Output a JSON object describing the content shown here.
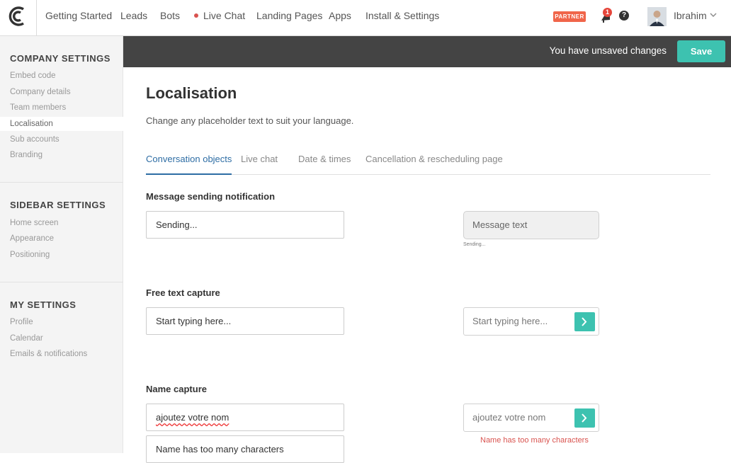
{
  "nav": {
    "items": [
      "Getting Started",
      "Leads",
      "Bots",
      "Live Chat",
      "Landing Pages",
      "Apps",
      "Install & Settings"
    ],
    "partner_badge": "PARTNER",
    "notification_count": "1",
    "help_icon": "question-circle-icon",
    "username": "Ibrahim"
  },
  "unsaved": {
    "message": "You have unsaved changes",
    "save_label": "Save"
  },
  "sidebar": {
    "company": {
      "heading": "COMPANY SETTINGS",
      "items": [
        "Embed code",
        "Company details",
        "Team members",
        "Localisation",
        "Sub accounts",
        "Branding"
      ]
    },
    "sidebar_settings": {
      "heading": "SIDEBAR SETTINGS",
      "items": [
        "Home screen",
        "Appearance",
        "Positioning"
      ]
    },
    "my": {
      "heading": "MY SETTINGS",
      "items": [
        "Profile",
        "Calendar",
        "Emails & notifications"
      ]
    },
    "active_item": "Localisation"
  },
  "page": {
    "title": "Localisation",
    "subtitle": "Change any placeholder text to suit your language.",
    "tabs": [
      "Conversation objects",
      "Live chat",
      "Date & times",
      "Cancellation & rescheduling page"
    ],
    "active_tab": "Conversation objects"
  },
  "sections": {
    "message_sending": {
      "label": "Message sending notification",
      "value": "Sending...",
      "preview_text": "Message text",
      "preview_status": "Sending..."
    },
    "free_text": {
      "label": "Free text capture",
      "value": "Start typing here...",
      "preview_placeholder": "Start typing here..."
    },
    "name_capture": {
      "label": "Name capture",
      "value": "ajoutez votre nom",
      "error_value": "Name has too many characters",
      "preview_placeholder": "ajoutez votre nom",
      "preview_error": "Name has too many characters"
    }
  },
  "colors": {
    "accent": "#3dc2b0",
    "tab_active": "#2e6da4",
    "partner": "#f0654a",
    "error": "#d9534f",
    "dark_bar": "#444444"
  }
}
